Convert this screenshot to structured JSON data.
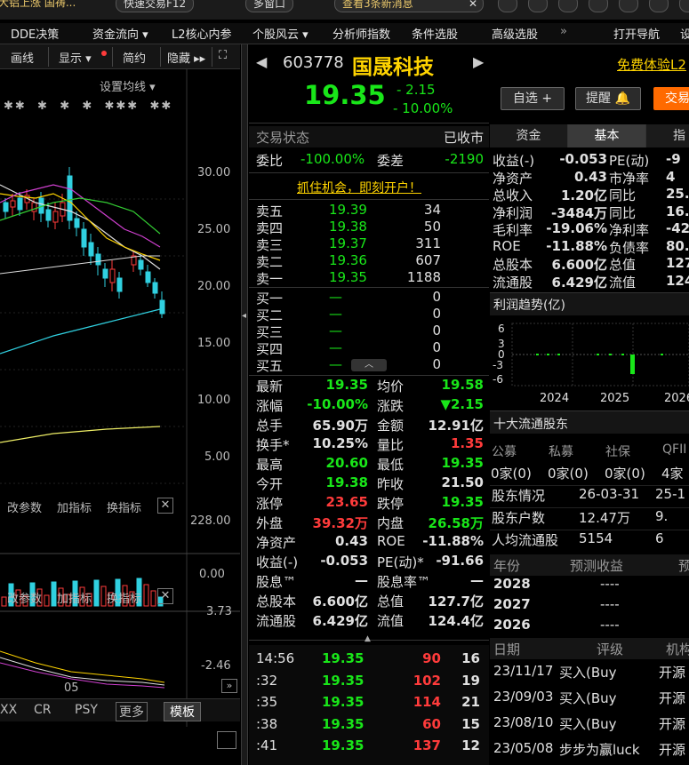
{
  "topbar": {
    "tab1": "大铝上涨 国祷...",
    "tab2": "快速交易F12",
    "tab3": "多窗口",
    "tab4": "查看3条新消息",
    "close": "✕"
  },
  "menu": {
    "items": [
      "DDE决策",
      "资金流向 ▾",
      "L2核心内参",
      "个股风云 ▾",
      "分析师指数",
      "条件选股",
      "高级选股",
      "»",
      "打开导航",
      "设"
    ]
  },
  "chart": {
    "header": [
      "画线",
      "显示 ▾",
      "简约",
      "隐藏 ▸▸",
      "⛶"
    ],
    "setting": "设置均线 ▾",
    "price_ticks": [
      "30.00",
      "25.00",
      "20.00",
      "15.00",
      "10.00",
      "5.00"
    ],
    "vol_bar": [
      "改参数",
      "加指标",
      "换指标"
    ],
    "vol_ticks": [
      "228.00",
      "0.00"
    ],
    "ind_bar": [
      "改参数",
      "加指标",
      "换指标"
    ],
    "ind_ticks": [
      "3.73",
      "-2.46"
    ],
    "date_label": "05",
    "bottom_tabs": [
      "XX",
      "CR",
      "PSY",
      "更多",
      "模板"
    ]
  },
  "stock": {
    "code": "603778",
    "name": "国晟科技",
    "price": "19.35",
    "change": "- 2.15",
    "pct": "- 10.00%",
    "free_trial": "免费体验L2",
    "btn_watch": "自选 +",
    "btn_alert": "提醒 🔔",
    "btn_trade": "交易"
  },
  "status": {
    "label": "交易状态",
    "value": "已收市"
  },
  "weibi": {
    "l1": "委比",
    "v1": "-100.00%",
    "l2": "委差",
    "v2": "-2190"
  },
  "promo": "抓住机会，即刻开户！",
  "asks": [
    {
      "l": "卖五",
      "p": "19.39",
      "q": "34"
    },
    {
      "l": "卖四",
      "p": "19.38",
      "q": "50"
    },
    {
      "l": "卖三",
      "p": "19.37",
      "q": "311"
    },
    {
      "l": "卖二",
      "p": "19.36",
      "q": "607"
    },
    {
      "l": "卖一",
      "p": "19.35",
      "q": "1188"
    }
  ],
  "bids": [
    {
      "l": "买一",
      "p": "—",
      "q": "0"
    },
    {
      "l": "买二",
      "p": "—",
      "q": "0"
    },
    {
      "l": "买三",
      "p": "—",
      "q": "0"
    },
    {
      "l": "买四",
      "p": "—",
      "q": "0"
    },
    {
      "l": "买五",
      "p": "—",
      "q": "0"
    }
  ],
  "quote": [
    [
      "最新",
      "19.35",
      "g",
      "均价",
      "19.58",
      "g"
    ],
    [
      "涨幅",
      "-10.00%",
      "g",
      "涨跌",
      "▼2.15",
      "g"
    ],
    [
      "总手",
      "65.90万",
      "w",
      "金额",
      "12.91亿",
      "w"
    ],
    [
      "换手*",
      "10.25%",
      "w",
      "量比",
      "1.35",
      "r"
    ],
    [
      "最高",
      "20.60",
      "g",
      "最低",
      "19.35",
      "g"
    ],
    [
      "今开",
      "19.38",
      "g",
      "昨收",
      "21.50",
      "w"
    ],
    [
      "涨停",
      "23.65",
      "r",
      "跌停",
      "19.35",
      "g"
    ],
    [
      "外盘",
      "39.32万",
      "r",
      "内盘",
      "26.58万",
      "g"
    ],
    [
      "净资产",
      "0.43",
      "w",
      "ROE",
      "-11.88%",
      "w"
    ],
    [
      "收益(-)",
      "-0.053",
      "w",
      "PE(动)*",
      "-91.66",
      "w"
    ],
    [
      "股息™",
      "—",
      "w",
      "股息率™",
      "—",
      "w"
    ],
    [
      "总股本",
      "6.600亿",
      "w",
      "总值",
      "127.7亿",
      "w"
    ],
    [
      "流通股",
      "6.429亿",
      "w",
      "流值",
      "124.4亿",
      "w"
    ]
  ],
  "ticks": [
    {
      "t": "14:56",
      "p": "19.35",
      "v": "90",
      "n": "16"
    },
    {
      "t": ":32",
      "p": "19.35",
      "v": "102",
      "n": "19"
    },
    {
      "t": ":35",
      "p": "19.35",
      "v": "114",
      "n": "21"
    },
    {
      "t": ":38",
      "p": "19.35",
      "v": "60",
      "n": "15"
    },
    {
      "t": ":41",
      "p": "19.35",
      "v": "137",
      "n": "12"
    }
  ],
  "right": {
    "tabs": [
      "资金",
      "基本",
      "指"
    ],
    "fund": [
      [
        "收益(-)",
        "-0.053",
        "PE(动)",
        "-9"
      ],
      [
        "净资产",
        "0.43",
        "市净率",
        "4"
      ],
      [
        "总收入",
        "1.20亿",
        "同比",
        "25."
      ],
      [
        "净利润",
        "-3484万",
        "同比",
        "16."
      ],
      [
        "毛利率",
        "-19.06%",
        "净利率",
        "-42."
      ],
      [
        "ROE",
        "-11.88%",
        "负债率",
        "80."
      ],
      [
        "总股本",
        "6.600亿",
        "总值",
        "127"
      ],
      [
        "流通股",
        "6.429亿",
        "流值",
        "124"
      ]
    ],
    "profit_title": "利润趋势(亿)",
    "profit_ticks": [
      "6",
      "3",
      "0",
      "-3",
      "-6"
    ],
    "profit_years": [
      "2024",
      "2025",
      "2026"
    ],
    "holders_title": "十大流通股东",
    "holder_types": [
      "公募",
      "私募",
      "社保",
      "QFII"
    ],
    "holder_counts": [
      "0家(0)",
      "0家(0)",
      "0家(0)",
      "4家"
    ],
    "holder_info": [
      [
        "股东情况",
        "26-03-31",
        "25-1"
      ],
      [
        "股东户数",
        "12.47万",
        "9."
      ],
      [
        "人均流通股",
        "5154",
        "6"
      ]
    ],
    "forecast_head": [
      "年份",
      "预测收益",
      "预"
    ],
    "forecast": [
      [
        "2028",
        "----"
      ],
      [
        "2027",
        "----"
      ],
      [
        "2026",
        "----"
      ]
    ],
    "rating_head": [
      "日期",
      "评级",
      "机构"
    ],
    "ratings": [
      [
        "23/11/17",
        "买入(Buy",
        "开源"
      ],
      [
        "23/09/03",
        "买入(Buy",
        "开源"
      ],
      [
        "23/08/10",
        "买入(Buy",
        "开源"
      ],
      [
        "23/05/08",
        "步步为赢luck",
        "开源"
      ]
    ]
  },
  "colors": {
    "green": "#19e619",
    "red": "#ff3b3b",
    "yellow": "#ffd400",
    "accent_orange": "#ff6a00"
  }
}
